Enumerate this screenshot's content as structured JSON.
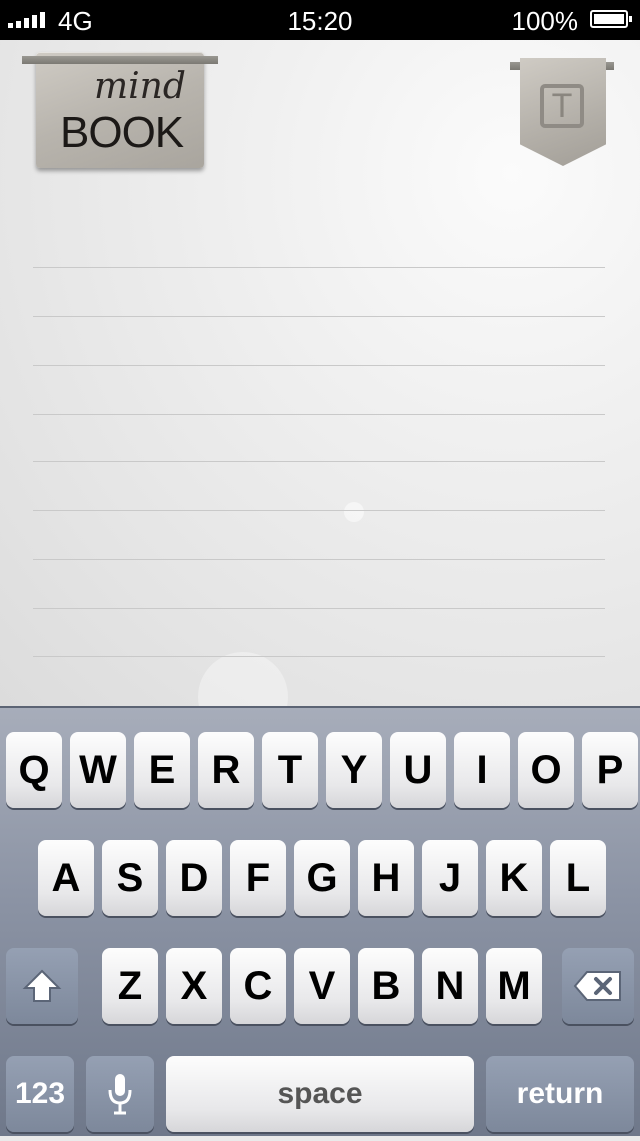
{
  "status_bar": {
    "carrier_network": "4G",
    "time": "15:20",
    "battery_percent": "100%"
  },
  "header": {
    "logo": {
      "script_text": "mind",
      "word_text": "BOOK"
    },
    "format_button": {
      "glyph": "T",
      "icon": "text-format-icon"
    }
  },
  "note": {
    "lines": 9
  },
  "keyboard": {
    "row1": [
      "Q",
      "W",
      "E",
      "R",
      "T",
      "Y",
      "U",
      "I",
      "O",
      "P"
    ],
    "row2": [
      "A",
      "S",
      "D",
      "F",
      "G",
      "H",
      "J",
      "K",
      "L"
    ],
    "row3": [
      "Z",
      "X",
      "C",
      "V",
      "B",
      "N",
      "M"
    ],
    "shift_icon": "shift-arrow-icon",
    "backspace_icon": "backspace-icon",
    "numbers_label": "123",
    "mic_icon": "microphone-icon",
    "space_label": "space",
    "return_label": "return"
  }
}
